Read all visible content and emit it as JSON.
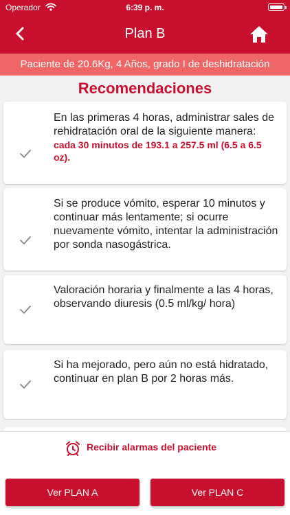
{
  "status_bar": {
    "carrier": "Operador",
    "time": "6:39 p. m."
  },
  "nav": {
    "title": "Plan B",
    "back_icon": "chevron-left-icon",
    "home_icon": "home-icon"
  },
  "patient_banner": "Paciente de 20.6Kg, 4 Años, grado I de deshidratación",
  "recommendations": {
    "title": "Recomendaciones",
    "items": [
      {
        "text": "En las primeras 4 horas, administrar sales de rehidratación oral de la siguiente manera:",
        "highlight": "cada 30 minutos de 193.1 a 257.5 ml (6.5 a 6.5 oz)."
      },
      {
        "text": "Si se produce vómito, esperar 10 minutos y continuar más lentamente; si ocurre nuevamente vómito, intentar la administración por sonda nasogástrica."
      },
      {
        "text": "Valoración horaria y finalmente a las 4 horas, observando diuresis (0.5 ml/kg/ hora)"
      },
      {
        "text": "Si ha mejorado, pero aún no está hidratado, continuar en plan B por 2 horas más."
      }
    ]
  },
  "alarm": {
    "label": "Recibir alarmas del paciente",
    "icon": "alarm-clock-icon"
  },
  "footer": {
    "plan_a_label": "Ver PLAN A",
    "plan_c_label": "Ver PLAN C"
  },
  "colors": {
    "primary": "#c8102e",
    "banner": "#f06565",
    "background": "#f2f2f2"
  }
}
